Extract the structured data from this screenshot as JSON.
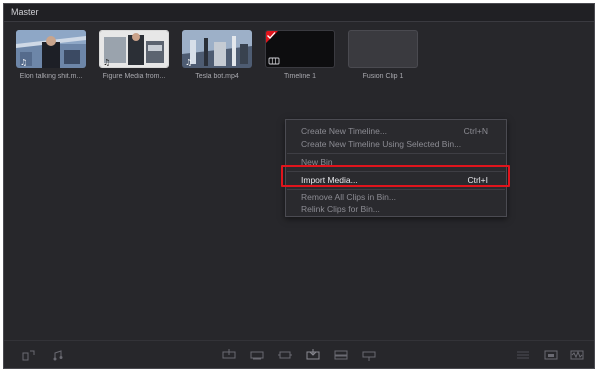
{
  "panel": {
    "title": "Master"
  },
  "clips": [
    {
      "name": "Elon talking shit.m...",
      "kind": "video"
    },
    {
      "name": "Figure Media from...",
      "kind": "video"
    },
    {
      "name": "Tesla bot.mp4",
      "kind": "video"
    },
    {
      "name": "Timeline 1",
      "kind": "timeline"
    },
    {
      "name": "Fusion Clip 1",
      "kind": "fusion"
    }
  ],
  "context_menu": {
    "items": [
      {
        "label": "Create New Timeline...",
        "shortcut": "Ctrl+N"
      },
      {
        "label": "Create New Timeline Using Selected Bin...",
        "shortcut": ""
      },
      {
        "label": "New Bin",
        "shortcut": ""
      },
      {
        "label": "Import Media...",
        "shortcut": "Ctrl+I",
        "highlighted": true
      },
      {
        "label": "Remove All Clips in Bin...",
        "shortcut": ""
      },
      {
        "label": "Relink Clips for Bin...",
        "shortcut": ""
      }
    ]
  },
  "colors": {
    "highlight_box": "#e0141c",
    "panel_bg": "#27272b",
    "timeline_badge": "#e0141c"
  },
  "toolbar_icons": [
    "import-audio-icon",
    "export-audio-icon",
    "insert-clip-icon",
    "overwrite-clip-icon",
    "replace-clip-icon",
    "append-clip-icon",
    "place-on-top-icon",
    "ripple-overwrite-icon",
    "list-view-icon",
    "thumbnail-view-icon",
    "waveform-icon"
  ]
}
